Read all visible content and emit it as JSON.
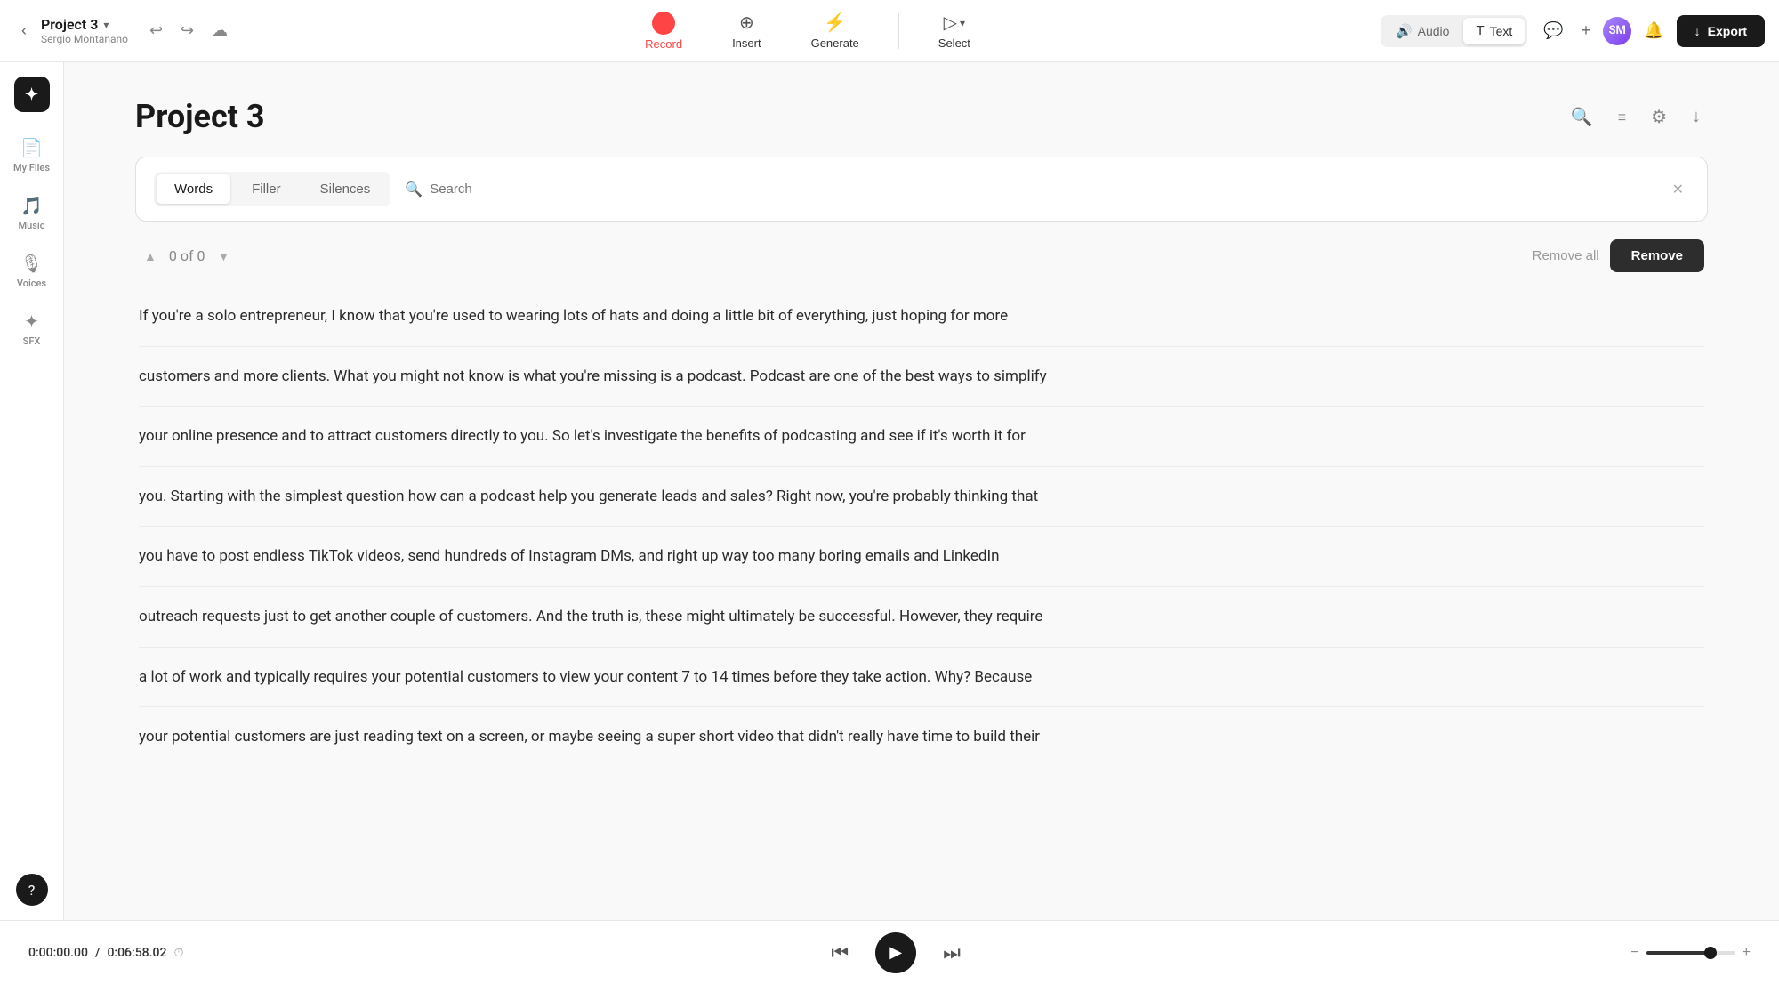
{
  "header": {
    "project_name": "Project 3",
    "project_dropdown": "▾",
    "author": "Sergio Montanano",
    "back_label": "‹",
    "undo_label": "↩",
    "redo_label": "↪",
    "cloud_label": "☁",
    "tools": [
      {
        "id": "record",
        "label": "Record",
        "icon": "●",
        "isRecord": true
      },
      {
        "id": "insert",
        "label": "Insert",
        "icon": "⊕"
      },
      {
        "id": "generate",
        "label": "Generate",
        "icon": "⚡"
      }
    ],
    "select_label": "Select",
    "select_icon": "▷",
    "audio_label": "Audio",
    "text_label": "Text",
    "chat_icon": "💬",
    "plus_icon": "+",
    "notification_icon": "🔔",
    "export_icon": "↓",
    "export_label": "Export"
  },
  "sidebar": {
    "items": [
      {
        "id": "my-files",
        "label": "My Files",
        "icon": "📄"
      },
      {
        "id": "music",
        "label": "Music",
        "icon": "🎵"
      },
      {
        "id": "voices",
        "label": "Voices",
        "icon": "🎙"
      },
      {
        "id": "sfx",
        "label": "SFX",
        "icon": "✦"
      }
    ],
    "support_icon": "?"
  },
  "main": {
    "title": "Project 3",
    "toolbar_icons": [
      "🔍",
      "☰",
      "⚙",
      "↓"
    ],
    "filter_tabs": [
      {
        "id": "words",
        "label": "Words",
        "active": true
      },
      {
        "id": "filler",
        "label": "Filler",
        "active": false
      },
      {
        "id": "silences",
        "label": "Silences",
        "active": false
      }
    ],
    "search_placeholder": "Search",
    "counter": "0 of 0",
    "remove_all_label": "Remove all",
    "remove_label": "Remove",
    "transcript": [
      "If you're a solo entrepreneur, I know that you're used to wearing lots of hats and doing a little bit of everything, just hoping for more",
      "customers and more clients. What you might not know is what you're missing is a podcast. Podcast are one of the best ways to simplify",
      "your online presence and to attract customers directly to you. So let's investigate the benefits of podcasting and see if it's worth it for",
      "you. Starting with the simplest question how can a podcast help you generate leads and sales? Right now, you're probably thinking that",
      "you have to post endless TikTok videos, send hundreds of Instagram DMs, and right up way too many boring emails and LinkedIn",
      "outreach requests just to get another couple of customers. And the truth is, these might ultimately be successful. However, they require",
      "a lot of work and typically requires your potential customers to view your content 7 to 14 times before they take action. Why? Because",
      "your potential customers are just reading text on a screen, or maybe seeing a super short video that didn't really have time to build their"
    ]
  },
  "player": {
    "current_time": "0:00:00.00",
    "total_time": "0:06:58.02",
    "clock_icon": "⏱",
    "rewind_icon": "⏮",
    "play_icon": "▶",
    "forward_icon": "⏭",
    "volume_minus_icon": "−",
    "volume_plus_icon": "+"
  }
}
